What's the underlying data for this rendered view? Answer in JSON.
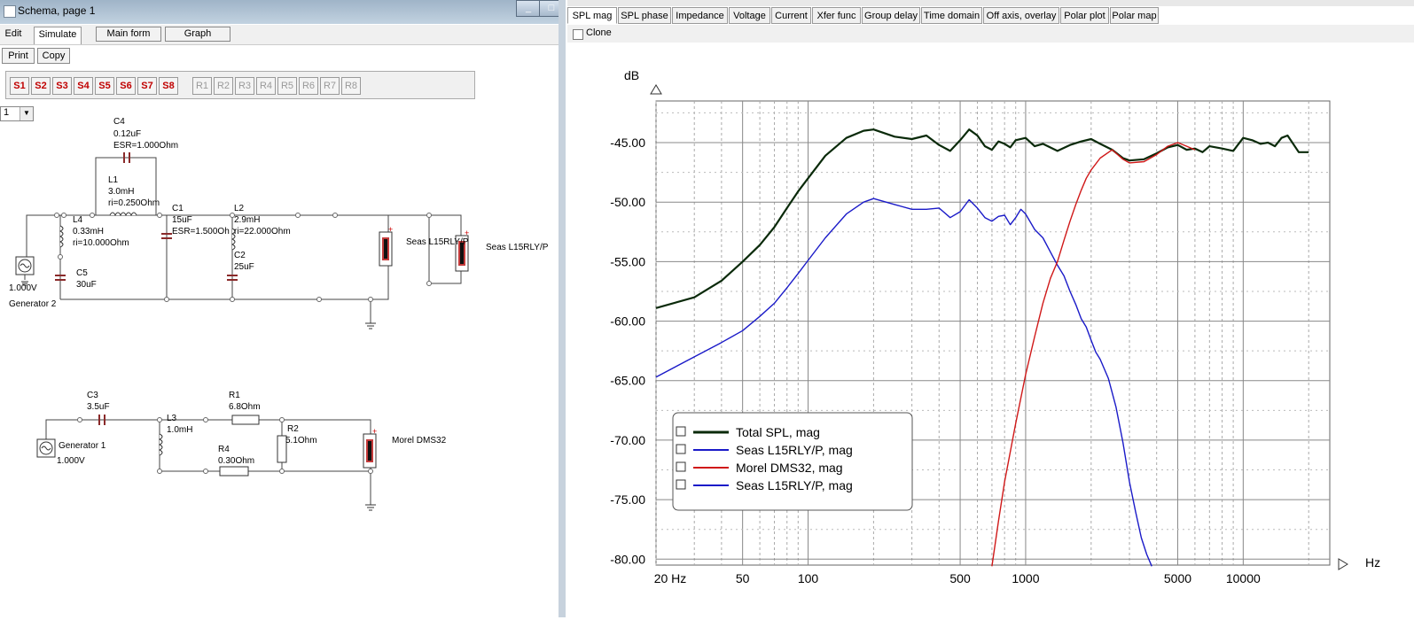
{
  "left_window": {
    "title": "Schema, page 1",
    "menu": [
      "Edit",
      "Simulate",
      "Main form",
      "Graph"
    ],
    "toolbar": {
      "print": "Print",
      "copy": "Copy"
    },
    "s_buttons": [
      "S1",
      "S2",
      "S3",
      "S4",
      "S5",
      "S6",
      "S7",
      "S8"
    ],
    "r_buttons": [
      "R1",
      "R2",
      "R3",
      "R4",
      "R5",
      "R6",
      "R7",
      "R8"
    ],
    "page_select": "1",
    "components": {
      "c4": [
        "C4",
        "0.12uF",
        "ESR=1.000Ohm"
      ],
      "l1": [
        "L1",
        "3.0mH",
        "ri=0.250Ohm"
      ],
      "l4": [
        "L4",
        "0.33mH",
        "ri=10.000Ohm"
      ],
      "c5": [
        "C5",
        "30uF"
      ],
      "c1": [
        "C1",
        "15uF",
        "ESR=1.500Oh"
      ],
      "l2": [
        "L2",
        "2.9mH",
        "ri=22.000Ohm"
      ],
      "c2": [
        "C2",
        "25uF"
      ],
      "gen2": [
        "1.000V",
        "Generator 2"
      ],
      "spk1": "Seas L15RLY/P",
      "spk2": "Seas L15RLY/P",
      "c3": [
        "C3",
        "3.5uF"
      ],
      "r1": [
        "R1",
        "6.8Ohm"
      ],
      "l3": [
        "L3",
        "1.0mH"
      ],
      "r2": [
        "R2",
        "5.1Ohm"
      ],
      "r4": [
        "R4",
        "0.30Ohm"
      ],
      "gen1": [
        "Generator 1",
        "1.000V"
      ],
      "spk3": "Morel DMS32"
    }
  },
  "right_window": {
    "tabs": [
      "SPL mag",
      "SPL phase",
      "Impedance",
      "Voltage",
      "Current",
      "Xfer func",
      "Group delay",
      "Time domain",
      "Off axis, overlay",
      "Polar plot",
      "Polar map"
    ],
    "active_tab": "SPL mag",
    "clone_label": "Clone"
  },
  "colors": {
    "total": "#0a2a0a",
    "seas": "#1a1ac8",
    "morel": "#d01818"
  },
  "chart_data": {
    "type": "line",
    "ylabel": "dB",
    "xlabel": "Hz",
    "xscale": "log",
    "xlim": [
      20,
      25000
    ],
    "ylim": [
      -80.5,
      -41.5
    ],
    "yticks": [
      -45,
      -50,
      -55,
      -60,
      -65,
      -70,
      -75,
      -80
    ],
    "ytick_labels": [
      "-45.00",
      "-50.00",
      "-55.00",
      "-60.00",
      "-65.00",
      "-70.00",
      "-75.00",
      "-80.00"
    ],
    "xticks": [
      20,
      50,
      100,
      500,
      1000,
      5000,
      10000
    ],
    "xtick_labels": [
      "20 Hz",
      "50",
      "100",
      "500",
      "1000",
      "5000",
      "10000"
    ],
    "grid": true,
    "legend": "bottom-left",
    "series": [
      {
        "name": "Total SPL, mag",
        "color": "#0a2a0a",
        "x": [
          20,
          30,
          40,
          50,
          60,
          70,
          80,
          90,
          100,
          120,
          150,
          180,
          200,
          250,
          300,
          350,
          400,
          450,
          500,
          550,
          600,
          650,
          700,
          750,
          800,
          850,
          900,
          1000,
          1100,
          1200,
          1400,
          1600,
          1800,
          2000,
          2200,
          2500,
          2800,
          3000,
          3500,
          4000,
          4500,
          5000,
          5500,
          6000,
          6500,
          7000,
          8000,
          9000,
          10000,
          11000,
          12000,
          13000,
          14000,
          15000,
          16000,
          18000,
          20000
        ],
        "y": [
          -58.9,
          -58.0,
          -56.6,
          -55.0,
          -53.6,
          -52.1,
          -50.5,
          -49.1,
          -48.0,
          -46.1,
          -44.6,
          -44.0,
          -43.9,
          -44.5,
          -44.7,
          -44.4,
          -45.2,
          -45.7,
          -44.8,
          -43.9,
          -44.4,
          -45.3,
          -45.6,
          -44.9,
          -45.1,
          -45.4,
          -44.8,
          -44.6,
          -45.3,
          -45.1,
          -45.7,
          -45.2,
          -44.9,
          -44.7,
          -45.1,
          -45.6,
          -46.3,
          -46.5,
          -46.4,
          -45.9,
          -45.4,
          -45.2,
          -45.6,
          -45.5,
          -45.8,
          -45.3,
          -45.5,
          -45.7,
          -44.6,
          -44.8,
          -45.1,
          -45.0,
          -45.3,
          -44.6,
          -44.4,
          -45.8,
          -45.8
        ]
      },
      {
        "name": "Seas L15RLY/P, mag",
        "color": "#1a1ac8",
        "x": [
          20,
          30,
          40,
          50,
          60,
          70,
          80,
          90,
          100,
          120,
          150,
          180,
          200,
          250,
          300,
          350,
          400,
          450,
          500,
          550,
          600,
          650,
          700,
          750,
          800,
          850,
          900,
          950,
          1000,
          1100,
          1200,
          1300,
          1400,
          1500,
          1600,
          1700,
          1800,
          1900,
          2000,
          2100,
          2200,
          2400,
          2600,
          2800,
          3000,
          3200,
          3400,
          3600,
          3800
        ],
        "y": [
          -64.7,
          -63.0,
          -61.8,
          -60.8,
          -59.6,
          -58.5,
          -57.2,
          -56.0,
          -54.9,
          -53.0,
          -51.0,
          -50.0,
          -49.7,
          -50.2,
          -50.6,
          -50.6,
          -50.5,
          -51.3,
          -50.8,
          -49.8,
          -50.5,
          -51.3,
          -51.6,
          -51.2,
          -51.1,
          -51.9,
          -51.3,
          -50.6,
          -51.0,
          -52.3,
          -53.0,
          -54.2,
          -55.3,
          -56.2,
          -57.5,
          -58.6,
          -59.8,
          -60.5,
          -61.6,
          -62.6,
          -63.2,
          -64.8,
          -67.2,
          -70.2,
          -73.5,
          -76.0,
          -78.2,
          -79.6,
          -80.6
        ]
      },
      {
        "name": "Morel DMS32, mag",
        "color": "#d01818",
        "x": [
          700,
          750,
          800,
          900,
          1000,
          1100,
          1200,
          1300,
          1400,
          1500,
          1600,
          1700,
          1800,
          1900,
          2000,
          2200,
          2500,
          2800,
          3000,
          3500,
          4000,
          4500,
          5000,
          5500,
          6000
        ],
        "y": [
          -80.6,
          -76.8,
          -73.5,
          -68.6,
          -64.5,
          -61.3,
          -58.5,
          -56.4,
          -55.0,
          -53.2,
          -51.6,
          -50.2,
          -49.0,
          -48.0,
          -47.3,
          -46.3,
          -45.6,
          -46.4,
          -46.7,
          -46.6,
          -46.0,
          -45.3,
          -45.0,
          -45.3,
          -45.6
        ]
      },
      {
        "name": "Seas L15RLY/P, mag",
        "color": "#1a1ac8",
        "hidden_duplicate": true
      }
    ]
  }
}
